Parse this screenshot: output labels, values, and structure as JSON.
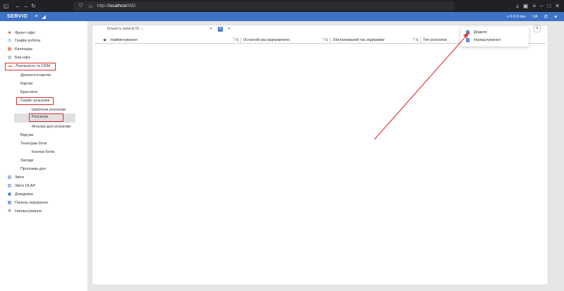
{
  "browser": {
    "url_prefix": "http://",
    "url_host": "localhost",
    "url_path": "/WD"
  },
  "header": {
    "logo": "SERVIO",
    "version": "v 0.0.0 dev",
    "language": "UA"
  },
  "sidebar": {
    "items": [
      {
        "label": "Фронт-офіс",
        "icon": "front-office-icon"
      },
      {
        "label": "Графік роботи",
        "icon": "clock-icon"
      },
      {
        "label": "Календар",
        "icon": "calendar-icon"
      },
      {
        "label": "Бек-офіс",
        "icon": "back-office-icon"
      },
      {
        "label": "Лояльність та CRM",
        "icon": "loyalty-icon"
      },
      {
        "label": "Дисконтні картки"
      },
      {
        "label": "Картки"
      },
      {
        "label": "Браслети"
      },
      {
        "label": "Сервіс розсилки"
      },
      {
        "label": "Шаблони розсилки"
      },
      {
        "label": "Розсилки"
      },
      {
        "label": "Фільтри для розсилки"
      },
      {
        "label": "Відгуки"
      },
      {
        "label": "Телеграм боти"
      },
      {
        "label": "Кнопки ботів"
      },
      {
        "label": "Заходи"
      },
      {
        "label": "Програма дня"
      },
      {
        "label": "Звіти",
        "icon": "reports-icon"
      },
      {
        "label": "Звіти OLAP",
        "icon": "olap-icon"
      },
      {
        "label": "Довідники",
        "icon": "directory-icon"
      },
      {
        "label": "Панель керування",
        "icon": "control-panel-icon"
      },
      {
        "label": "Налаштування",
        "icon": "settings-icon"
      }
    ]
  },
  "toolbar": {
    "records_label": "Кількість записів 50",
    "badge": "5",
    "plus": "+"
  },
  "table": {
    "columns": [
      "Найменування",
      "Останній раз відправлено",
      "Запланований час відправки",
      "Тип розсилки"
    ]
  },
  "dropdown": {
    "items": [
      "Додати",
      "Налаштування"
    ]
  },
  "colors": {
    "header_blue": "#3d72c6",
    "highlight_red": "#d32f2f",
    "arrow_red": "#e53935"
  }
}
